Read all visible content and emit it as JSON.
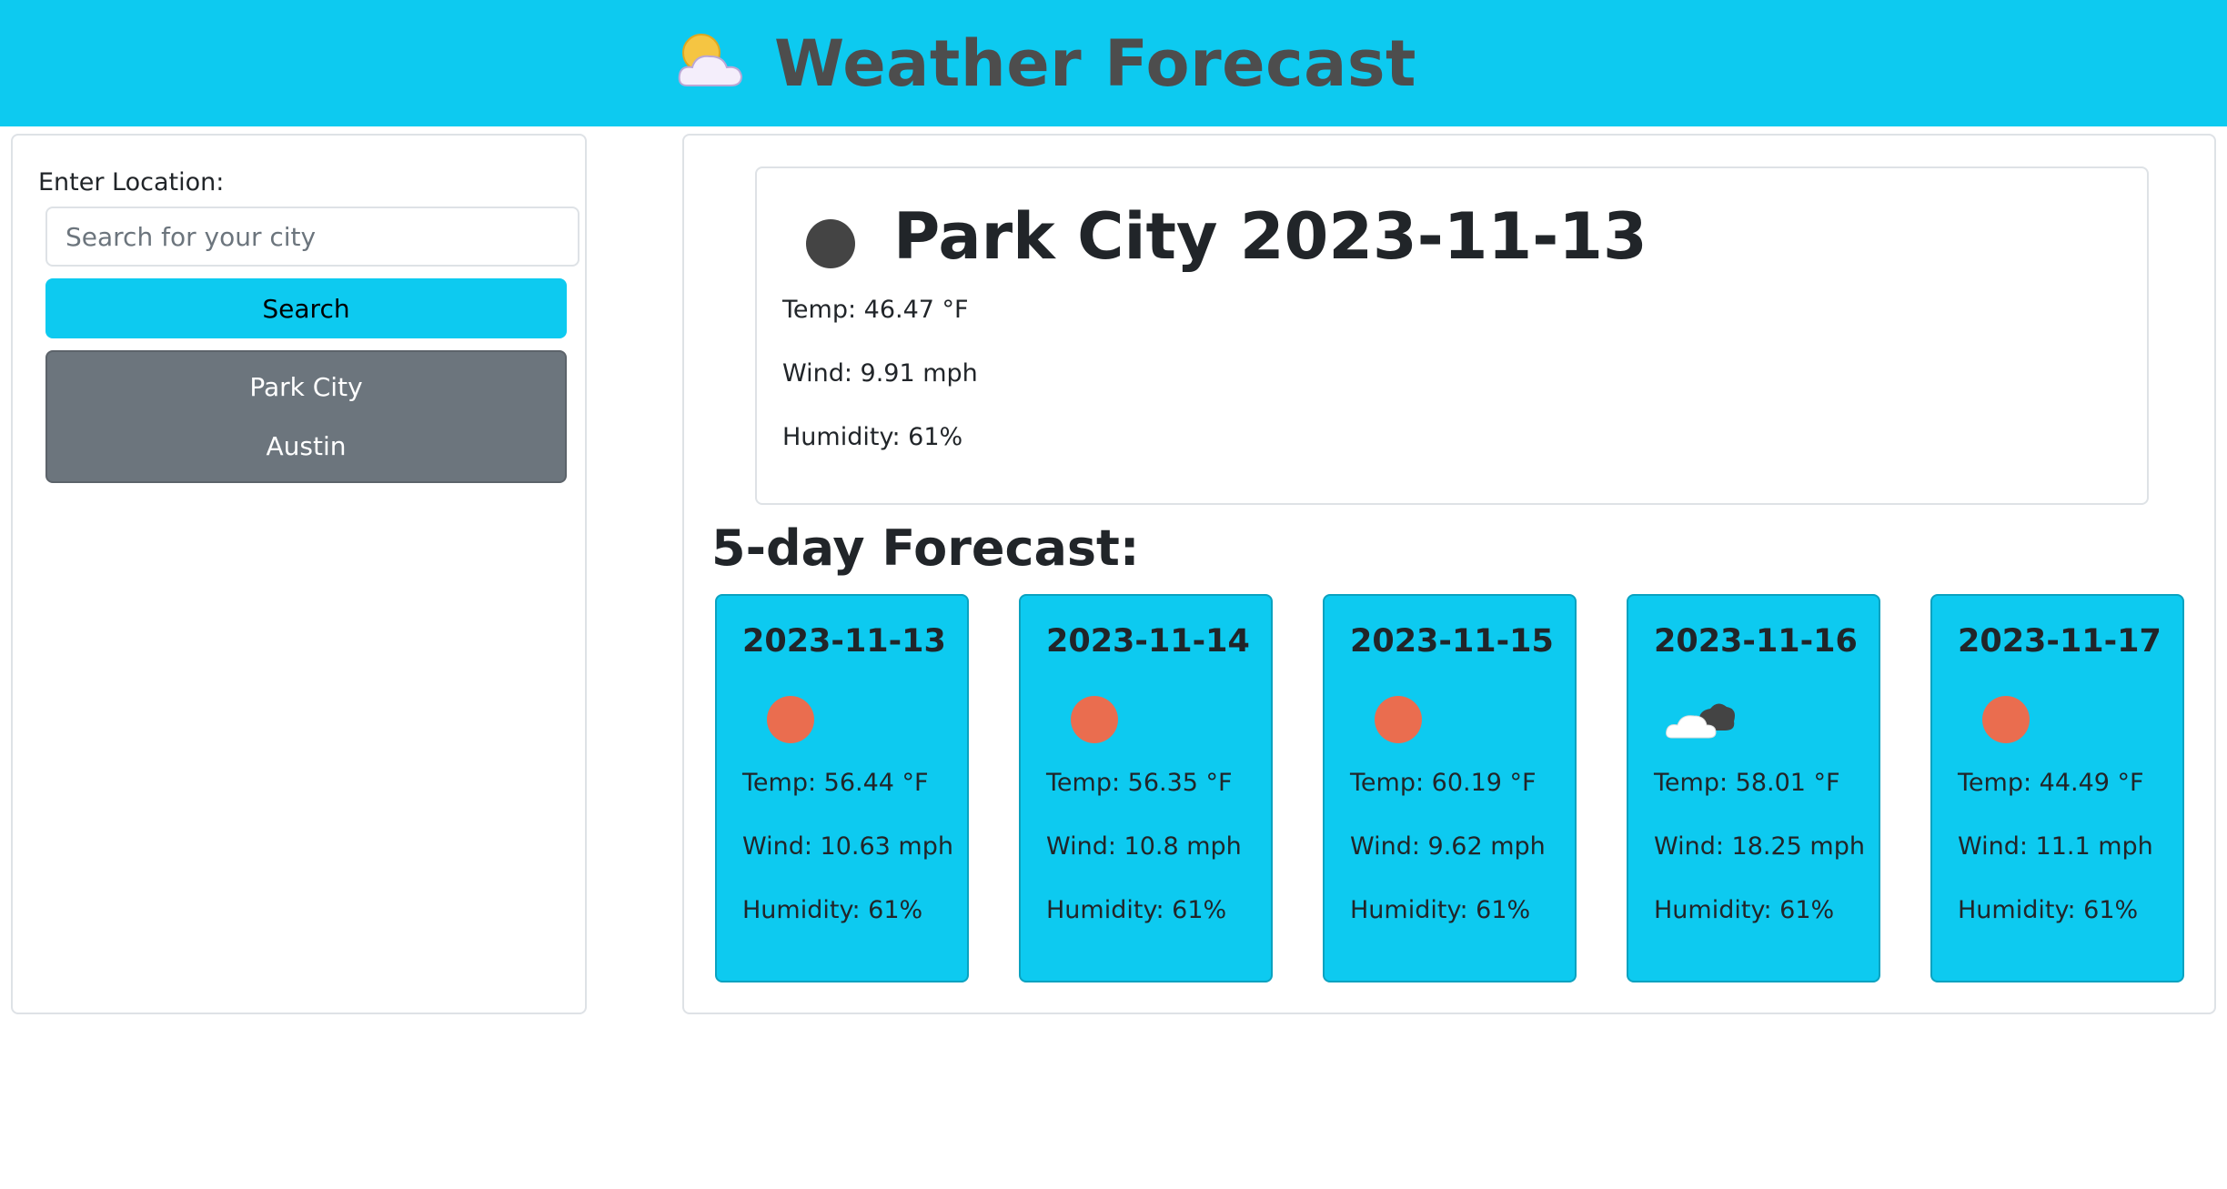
{
  "header": {
    "title": "Weather Forecast",
    "icon": "sun-behind-cloud-icon"
  },
  "sidebar": {
    "location_label": "Enter Location:",
    "search_placeholder": "Search for your city",
    "search_value": "",
    "search_button_label": "Search",
    "history": [
      "Park City",
      "Austin"
    ]
  },
  "current": {
    "title": "Park City 2023-11-13",
    "icon": "dark-circle-weather-icon",
    "temp": "Temp: 46.47 °F",
    "wind": "Wind: 9.91 mph",
    "humidity": "Humidity: 61%"
  },
  "forecast": {
    "heading": "5-day Forecast:",
    "days": [
      {
        "date": "2023-11-13",
        "icon": "sun-icon",
        "temp": "Temp: 56.44 °F",
        "wind": "Wind: 10.63 mph",
        "humidity": "Humidity: 61%"
      },
      {
        "date": "2023-11-14",
        "icon": "sun-icon",
        "temp": "Temp: 56.35 °F",
        "wind": "Wind: 10.8 mph",
        "humidity": "Humidity: 61%"
      },
      {
        "date": "2023-11-15",
        "icon": "sun-icon",
        "temp": "Temp: 60.19 °F",
        "wind": "Wind: 9.62 mph",
        "humidity": "Humidity: 61%"
      },
      {
        "date": "2023-11-16",
        "icon": "cloud-icon",
        "temp": "Temp: 58.01 °F",
        "wind": "Wind: 18.25 mph",
        "humidity": "Humidity: 61%"
      },
      {
        "date": "2023-11-17",
        "icon": "sun-icon",
        "temp": "Temp: 44.49 °F",
        "wind": "Wind: 11.1 mph",
        "humidity": "Humidity: 61%"
      }
    ]
  },
  "colors": {
    "accent": "#0dcaf0",
    "history_bg": "#6c757d",
    "sun": "#ea6d4f",
    "title_text": "#4d4d4d"
  }
}
